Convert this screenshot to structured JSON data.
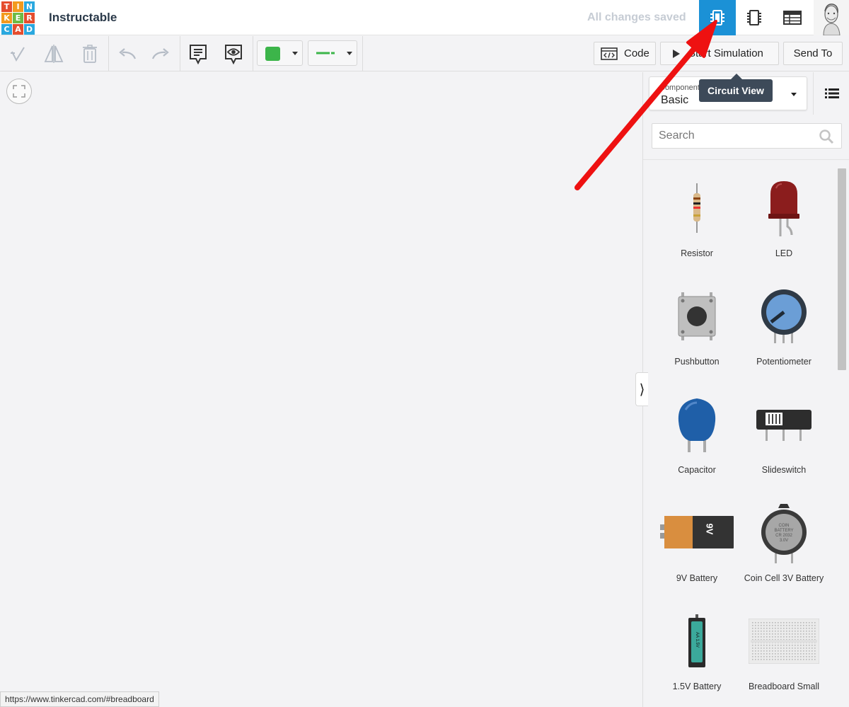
{
  "app": {
    "logo_letters": [
      "T",
      "I",
      "N",
      "K",
      "E",
      "R",
      "C",
      "A",
      "D"
    ],
    "project_title": "Instructable",
    "save_status": "All changes saved"
  },
  "views": {
    "circuit_view_label": "Circuit View"
  },
  "toolbar": {
    "code_label": "Code",
    "simulation_label": "Start Simulation",
    "send_to_label": "Send To",
    "color_value": "#3cb54a",
    "wire_color": "#3cb54a"
  },
  "panel": {
    "components_label": "Components",
    "components_value": "Basic",
    "search_placeholder": "Search",
    "items": [
      {
        "label": "Resistor"
      },
      {
        "label": "LED"
      },
      {
        "label": "Pushbutton"
      },
      {
        "label": "Potentiometer"
      },
      {
        "label": "Capacitor"
      },
      {
        "label": "Slideswitch"
      },
      {
        "label": "9V Battery",
        "art_text": "9V"
      },
      {
        "label": "Coin Cell 3V Battery",
        "art_text": "COIN BATTERY CR 2032 3.0V"
      },
      {
        "label": "1.5V Battery",
        "art_text": "AA 1.5V"
      },
      {
        "label": "Breadboard Small"
      }
    ]
  },
  "status_bar": {
    "url": "https://www.tinkercad.com/#breadboard"
  },
  "colors": {
    "accent": "#1b91d6",
    "annotation_arrow": "#ee1111",
    "logo": [
      "#e54d2e",
      "#f39a1d",
      "#2aa8df",
      "#f39a1d",
      "#6dbb45",
      "#e54d2e",
      "#2aa8df",
      "#e54d2e",
      "#2aa8df"
    ]
  }
}
